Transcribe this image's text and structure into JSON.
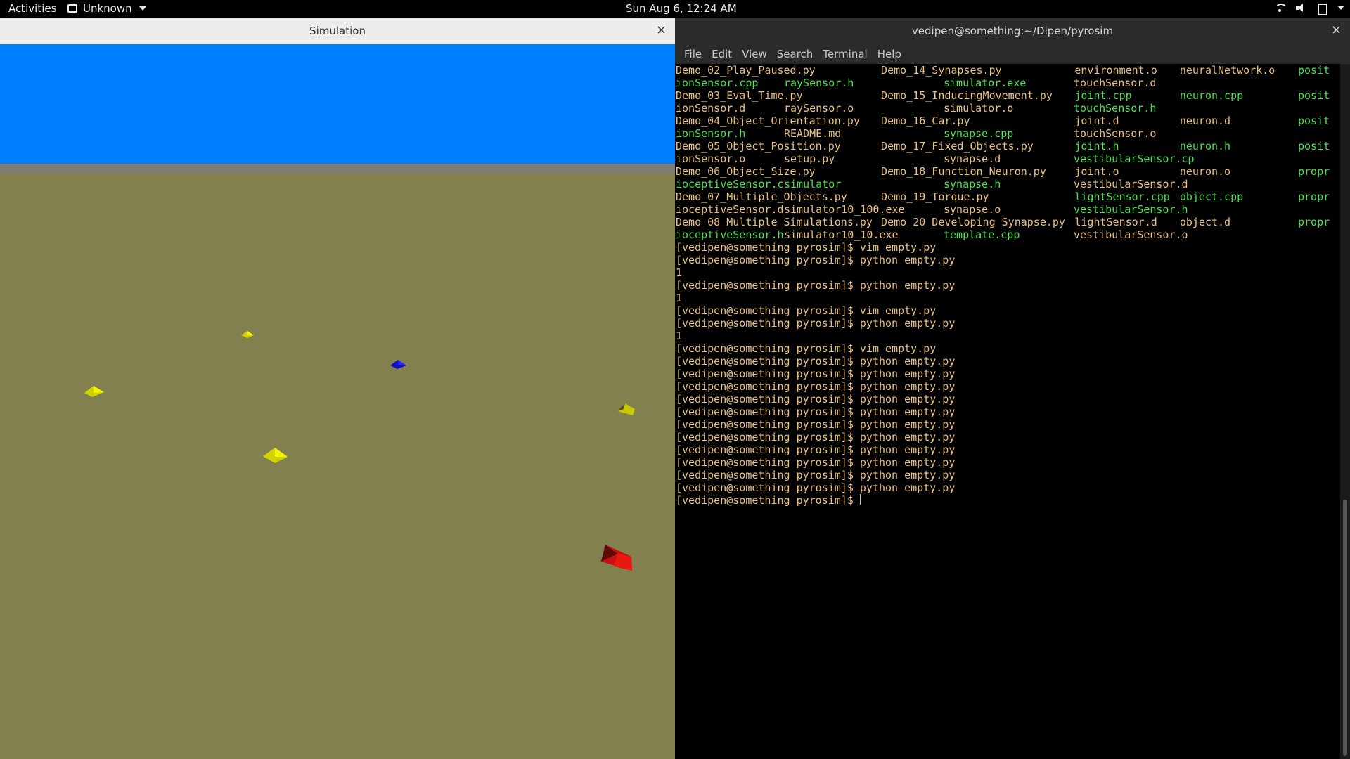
{
  "topbar": {
    "activities": "Activities",
    "app_name": "Unknown",
    "clock": "Sun Aug  6, 12:24 AM",
    "icons": [
      "wifi-icon",
      "volume-icon",
      "battery-icon",
      "system-menu-caret"
    ]
  },
  "sim_window": {
    "title": "Simulation",
    "close": "×",
    "colors": {
      "sky": "#0080ff",
      "ground": "#83804f",
      "horizon": "#7f7d73"
    }
  },
  "terminal": {
    "title": "vedipen@something:~/Dipen/pyrosim",
    "close": "×",
    "menu": [
      "File",
      "Edit",
      "View",
      "Search",
      "Terminal",
      "Help"
    ],
    "ls_rows": [
      [
        "Demo_02_Play_Paused.py",
        "Demo_14_Synapses.py",
        "environment.o",
        "neuralNetwork.o",
        "posit"
      ],
      [
        "ionSensor.cpp",
        "raySensor.h",
        "simulator.exe",
        "touchSensor.d",
        ""
      ],
      [
        "Demo_03_Eval_Time.py",
        "Demo_15_InducingMovement.py",
        "joint.cpp",
        "neuron.cpp",
        "posit"
      ],
      [
        "ionSensor.d",
        "raySensor.o",
        "simulator.o",
        "touchSensor.h",
        ""
      ],
      [
        "Demo_04_Object_Orientation.py",
        "Demo_16_Car.py",
        "joint.d",
        "neuron.d",
        "posit"
      ],
      [
        "ionSensor.h",
        "README.md",
        "synapse.cpp",
        "touchSensor.o",
        ""
      ],
      [
        "Demo_05_Object_Position.py",
        "Demo_17_Fixed_Objects.py",
        "joint.h",
        "neuron.h",
        "posit"
      ],
      [
        "ionSensor.o",
        "setup.py",
        "synapse.d",
        "vestibularSensor.cpp",
        ""
      ],
      [
        "Demo_06_Object_Size.py",
        "Demo_18_Function_Neuron.py",
        "joint.o",
        "neuron.o",
        "propr"
      ],
      [
        "ioceptiveSensor.cpp",
        "simulator",
        "synapse.h",
        "vestibularSensor.d",
        ""
      ],
      [
        "Demo_07_Multiple_Objects.py",
        "Demo_19_Torque.py",
        "lightSensor.cpp",
        "object.cpp",
        "propr"
      ],
      [
        "ioceptiveSensor.d",
        "simulator10_100.exe",
        "synapse.o",
        "vestibularSensor.h",
        ""
      ],
      [
        "Demo_08_Multiple_Simulations.py",
        "Demo_20_Developing_Synapse.py",
        "lightSensor.d",
        "object.d",
        "propr"
      ],
      [
        "ioceptiveSensor.h",
        "simulator10_10.exe",
        "template.cpp",
        "vestibularSensor.o",
        ""
      ]
    ],
    "ls_green": [
      [
        false,
        false,
        false,
        false,
        true
      ],
      [
        true,
        true,
        true,
        false,
        false
      ],
      [
        false,
        false,
        true,
        true,
        true
      ],
      [
        false,
        false,
        false,
        true,
        false
      ],
      [
        false,
        false,
        false,
        false,
        true
      ],
      [
        true,
        false,
        true,
        false,
        false
      ],
      [
        false,
        false,
        true,
        true,
        true
      ],
      [
        false,
        false,
        false,
        true,
        false
      ],
      [
        false,
        false,
        false,
        false,
        true
      ],
      [
        true,
        true,
        true,
        false,
        false
      ],
      [
        false,
        false,
        true,
        true,
        true
      ],
      [
        false,
        false,
        false,
        true,
        false
      ],
      [
        false,
        false,
        false,
        false,
        true
      ],
      [
        true,
        false,
        true,
        false,
        false
      ]
    ],
    "history": [
      "[vedipen@something pyrosim]$ vim empty.py",
      "[vedipen@something pyrosim]$ python empty.py",
      "1",
      "[vedipen@something pyrosim]$ python empty.py",
      "1",
      "[vedipen@something pyrosim]$ vim empty.py",
      "[vedipen@something pyrosim]$ python empty.py",
      "1",
      "[vedipen@something pyrosim]$ vim empty.py",
      "[vedipen@something pyrosim]$ python empty.py",
      "[vedipen@something pyrosim]$ python empty.py",
      "[vedipen@something pyrosim]$ python empty.py",
      "[vedipen@something pyrosim]$ python empty.py",
      "[vedipen@something pyrosim]$ python empty.py",
      "[vedipen@something pyrosim]$ python empty.py",
      "[vedipen@something pyrosim]$ python empty.py",
      "[vedipen@something pyrosim]$ python empty.py",
      "[vedipen@something pyrosim]$ python empty.py",
      "[vedipen@something pyrosim]$ python empty.py",
      "[vedipen@something pyrosim]$ python empty.py"
    ],
    "prompt": "[vedipen@something pyrosim]$ ",
    "colors": {
      "text": "#e8c07f",
      "executable": "#4ee04e",
      "background": "#000000"
    }
  }
}
